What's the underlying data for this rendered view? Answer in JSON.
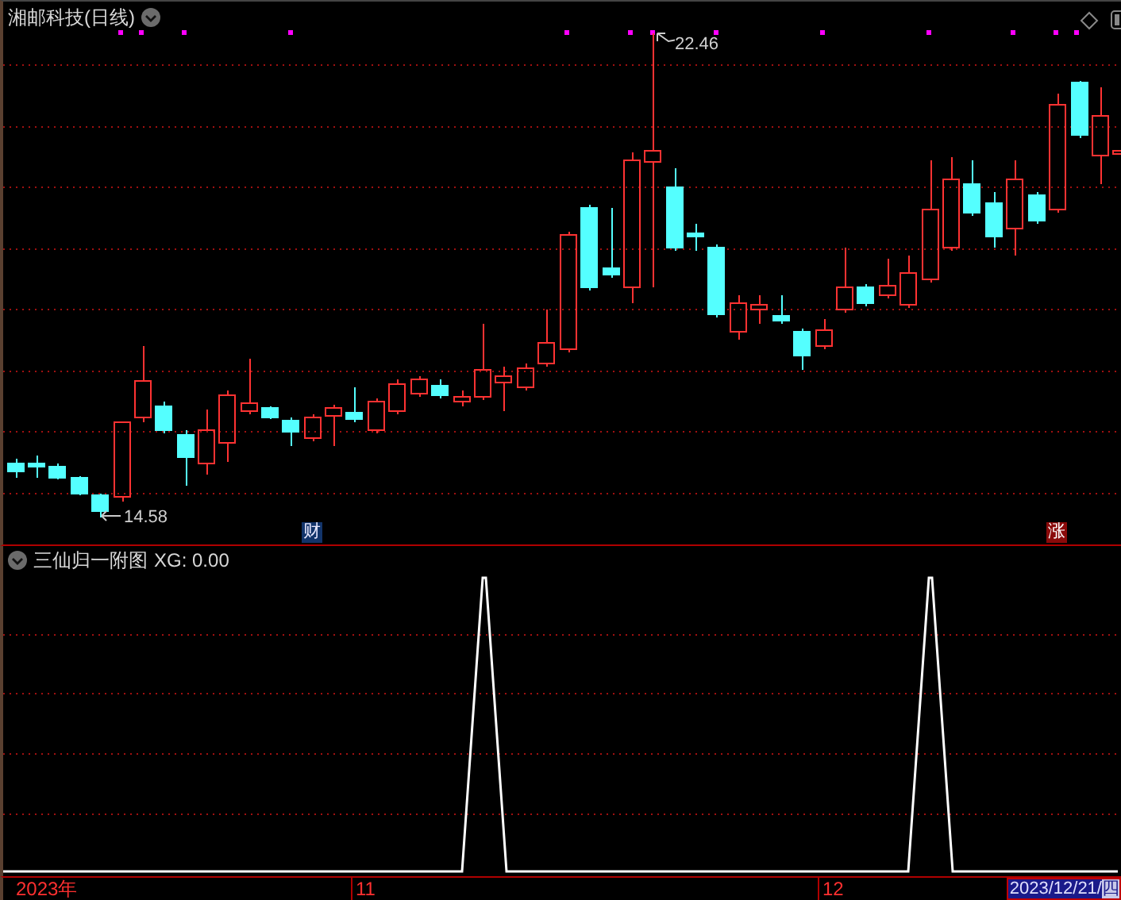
{
  "main_panel": {
    "title": "湘邮科技(日线)",
    "high_label": "22.46",
    "low_label": "14.58",
    "markers": [
      {
        "text": "财",
        "kind": "news"
      },
      {
        "text": "涨",
        "kind": "limit"
      }
    ]
  },
  "indicator_panel": {
    "title": "三仙归一附图",
    "value_label": "XG: 0.00"
  },
  "time_axis": {
    "labels": [
      "2023年",
      "11",
      "12"
    ],
    "current_date": "2023/12/21/",
    "weekday": "四"
  }
}
